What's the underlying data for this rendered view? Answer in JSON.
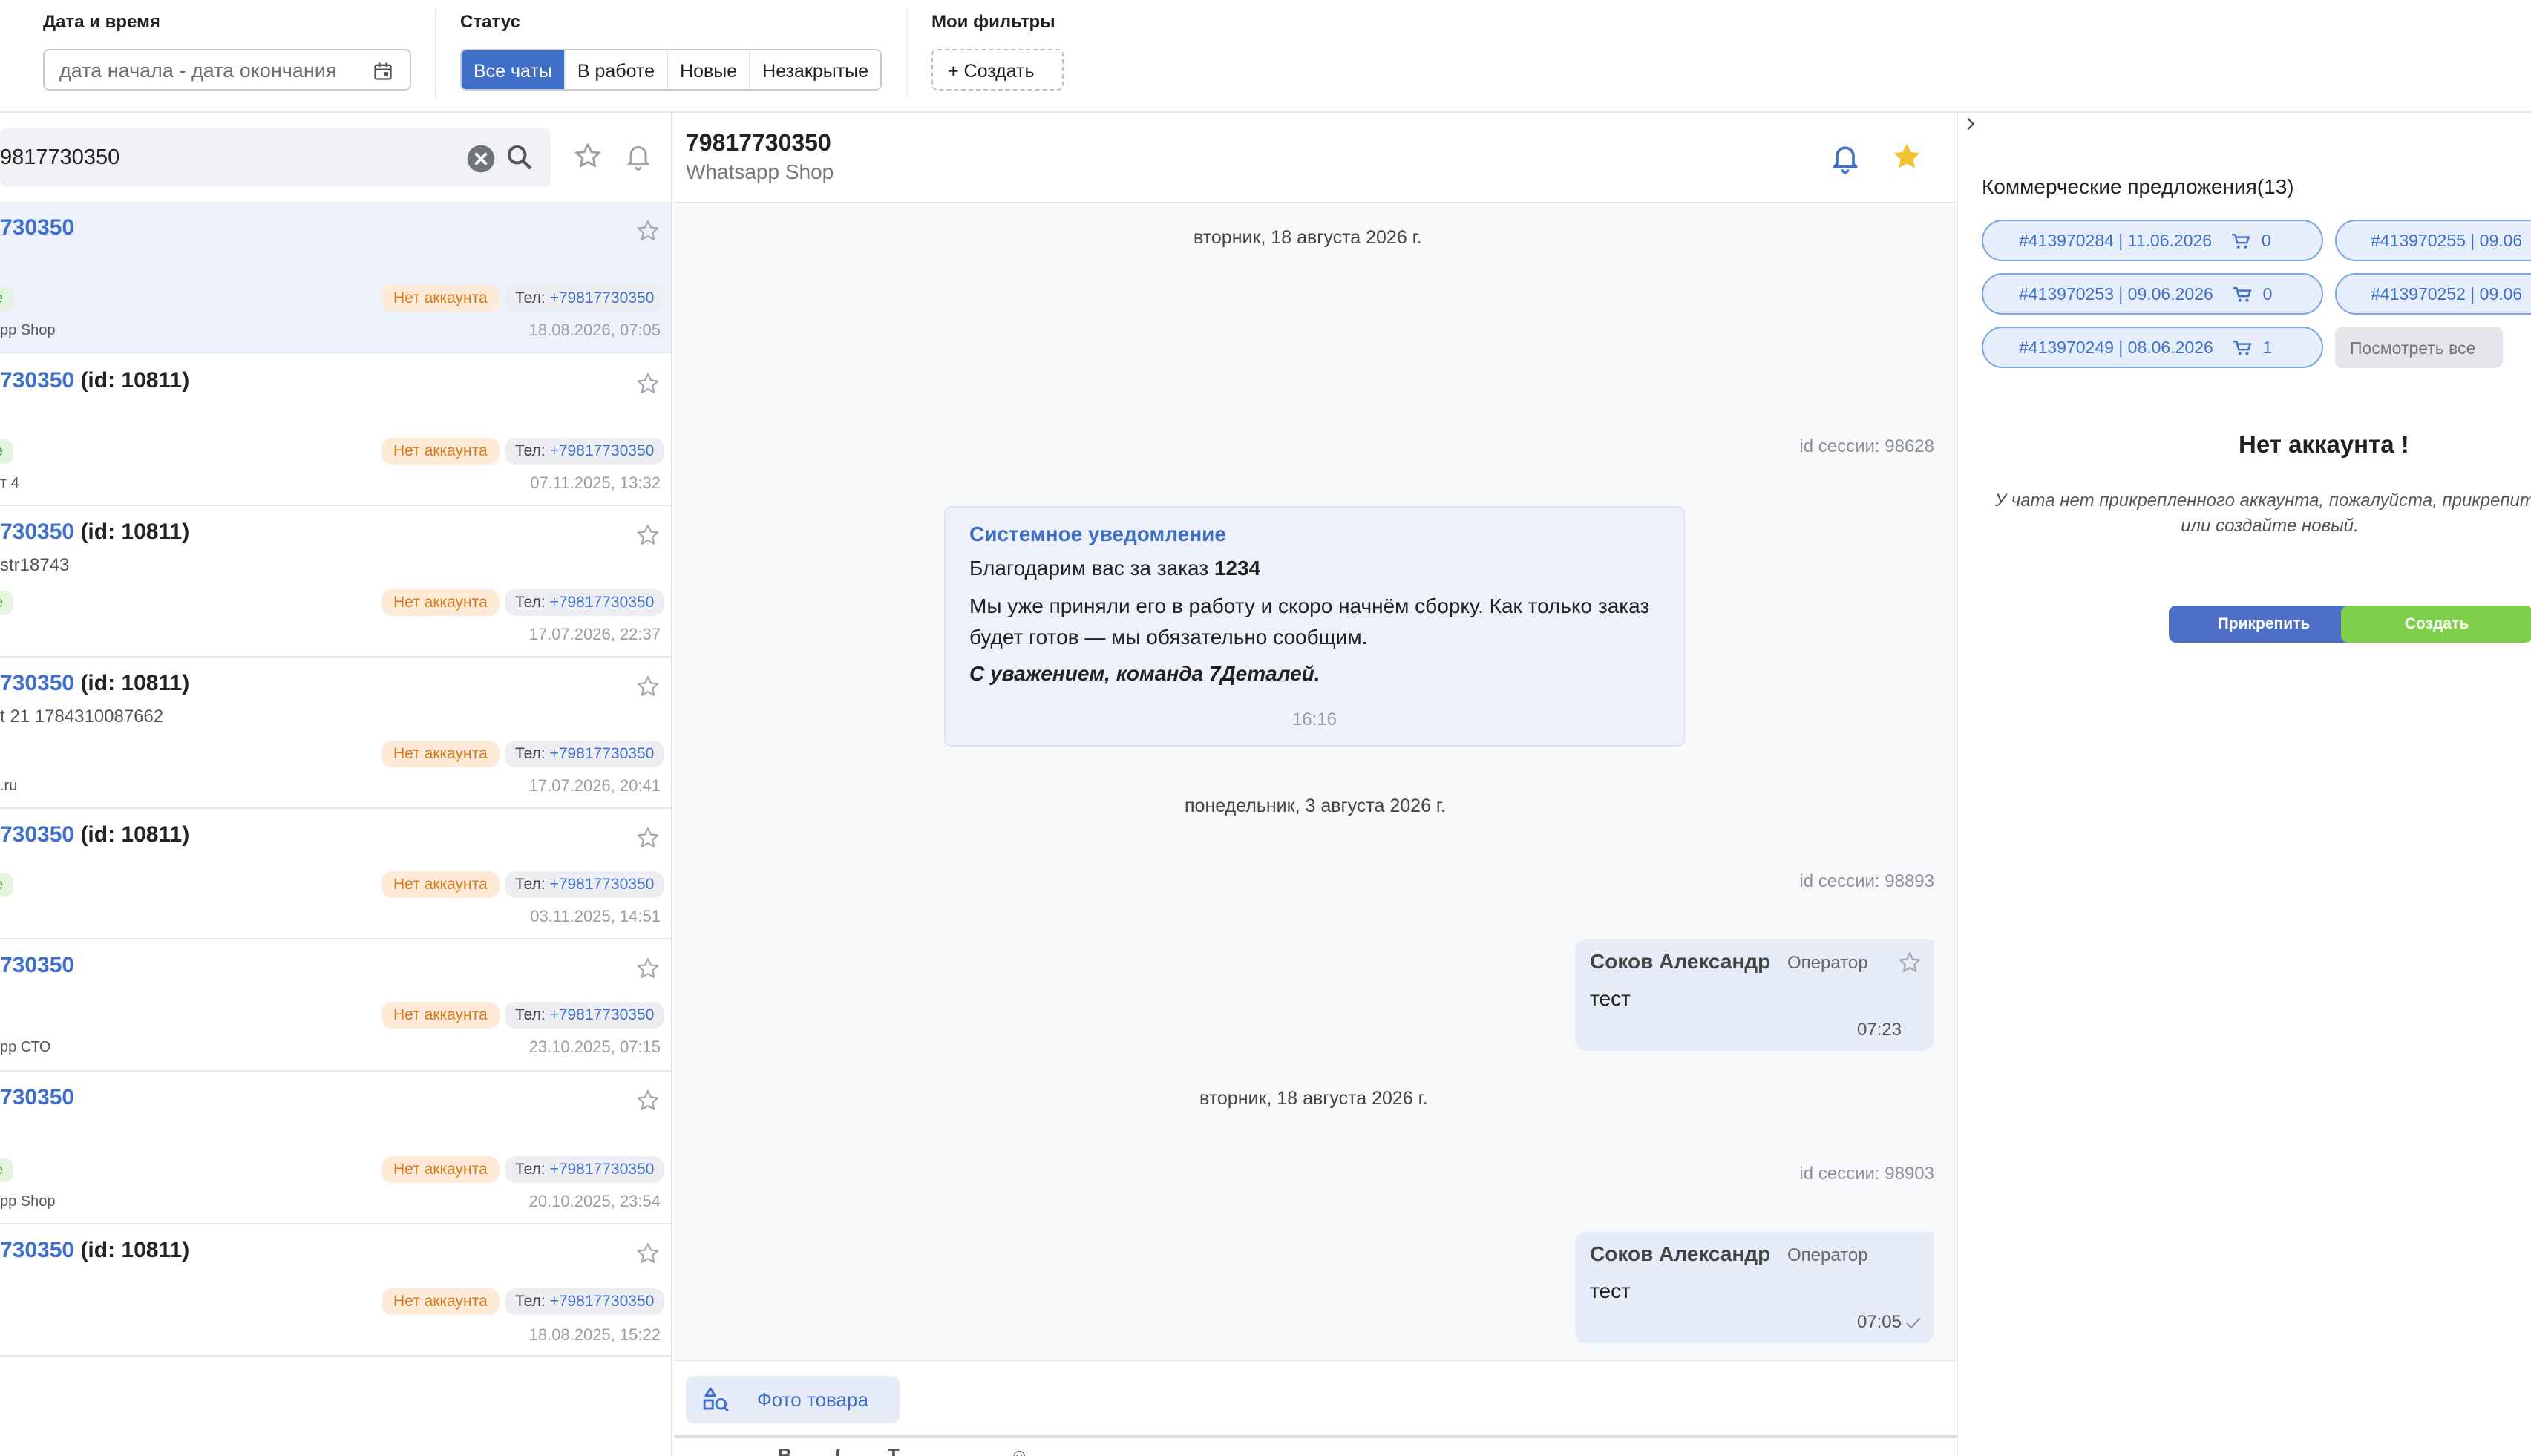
{
  "filters": {
    "date_label": "Дата и время",
    "date_placeholder": "дата начала - дата окончания",
    "status_label": "Статус",
    "status_options": [
      "Все чаты",
      "В работе",
      "Новые",
      "Незакрытые"
    ],
    "status_selected": "Все чаты",
    "my_filters_label": "Мои фильтры",
    "create_filter": "+ Создать"
  },
  "search": {
    "value": "9817730350"
  },
  "chats": [
    {
      "title_phone": "730350",
      "title_id": "",
      "subtitle": "",
      "tag_green": "те",
      "tag_noacc": "Нет аккаунта",
      "phone_prefix": "Тел: ",
      "phone": "+79817730350",
      "source": "pp Shop",
      "time": "18.08.2026, 07:05"
    },
    {
      "title_phone": "730350",
      "title_id": " (id: 10811)",
      "subtitle": "",
      "tag_green": "те",
      "tag_noacc": "Нет аккаунта",
      "phone_prefix": "Тел: ",
      "phone": "+79817730350",
      "source": "т 4",
      "time": "07.11.2025, 13:32"
    },
    {
      "title_phone": "730350",
      "title_id": " (id: 10811)",
      "subtitle": "str18743",
      "tag_green": "те",
      "tag_noacc": "Нет аккаунта",
      "phone_prefix": "Тел: ",
      "phone": "+79817730350",
      "source": "",
      "time": "17.07.2026, 22:37"
    },
    {
      "title_phone": "730350",
      "title_id": " (id: 10811)",
      "subtitle": "t 21 1784310087662",
      "tag_green": "",
      "tag_noacc": "Нет аккаунта",
      "phone_prefix": "Тел: ",
      "phone": "+79817730350",
      "source": ".ru",
      "time": "17.07.2026, 20:41"
    },
    {
      "title_phone": "730350",
      "title_id": " (id: 10811)",
      "subtitle": "",
      "tag_green": "те",
      "tag_noacc": "Нет аккаунта",
      "phone_prefix": "Тел: ",
      "phone": "+79817730350",
      "source": "",
      "time": "03.11.2025, 14:51"
    },
    {
      "title_phone": "730350",
      "title_id": "",
      "subtitle": "",
      "tag_green": "",
      "tag_noacc": "Нет аккаунта",
      "phone_prefix": "Тел: ",
      "phone": "+79817730350",
      "source": "pp СТО",
      "time": "23.10.2025, 07:15"
    },
    {
      "title_phone": "730350",
      "title_id": "",
      "subtitle": "",
      "tag_green": "те",
      "tag_noacc": "Нет аккаунта",
      "phone_prefix": "Тел: ",
      "phone": "+79817730350",
      "source": "pp Shop",
      "time": "20.10.2025, 23:54"
    },
    {
      "title_phone": "730350",
      "title_id": " (id: 10811)",
      "subtitle": "",
      "tag_green": "",
      "tag_noacc": "Нет аккаунта",
      "phone_prefix": "Тел: ",
      "phone": "+79817730350",
      "source": "",
      "time": "18.08.2025, 15:22"
    }
  ],
  "chat": {
    "title": "79817730350",
    "subtitle": "Whatsapp Shop",
    "date1": "вторник, 18 августа 2026 г.",
    "session1": "id сессии: 98628",
    "system": {
      "title": "Системное уведомление",
      "line1_prefix": "Благодарим вас за заказ ",
      "line1_order": "1234",
      "body": "Мы уже приняли его в работу и скоро начнём сборку. Как только заказ будет готов — мы обязательно сообщим.",
      "signature": "С уважением, команда 7Деталей.",
      "time": "16:16"
    },
    "date2": "понедельник, 3 августа 2026 г.",
    "session2": "id сессии: 98893",
    "msg1": {
      "name": "Соков Александр",
      "role": "Оператор",
      "text": "тест",
      "time": "07:23"
    },
    "date3": "вторник, 18 августа 2026 г.",
    "session3": "id сессии: 98903",
    "msg2": {
      "name": "Соков Александр",
      "role": "Оператор",
      "text": "тест",
      "time": "07:05"
    },
    "photo_button": "Фото товара"
  },
  "right": {
    "offers_title": "Коммерческие предложения(13)",
    "offers": [
      {
        "text": "#413970284  |  11.06.2026",
        "count": "0"
      },
      {
        "text": "#413970255  |  09.06",
        "count": ""
      },
      {
        "text": "#413970253  |  09.06.2026",
        "count": "0"
      },
      {
        "text": "#413970252  |  09.06",
        "count": ""
      },
      {
        "text": "#413970249  |  08.06.2026",
        "count": "1"
      }
    ],
    "view_all": "Посмотреть все",
    "no_account_title": "Нет аккаунта !",
    "no_account_text": "У чата нет прикрепленного аккаунта, пожалуйста, прикрепите или создайте новый.",
    "attach_button": "Прикрепить",
    "create_button": "Создать"
  },
  "colors": {
    "accent": "#3f6fc9",
    "star": "#f2c230",
    "green": "#7ed04a",
    "orange": "#d8781c"
  }
}
